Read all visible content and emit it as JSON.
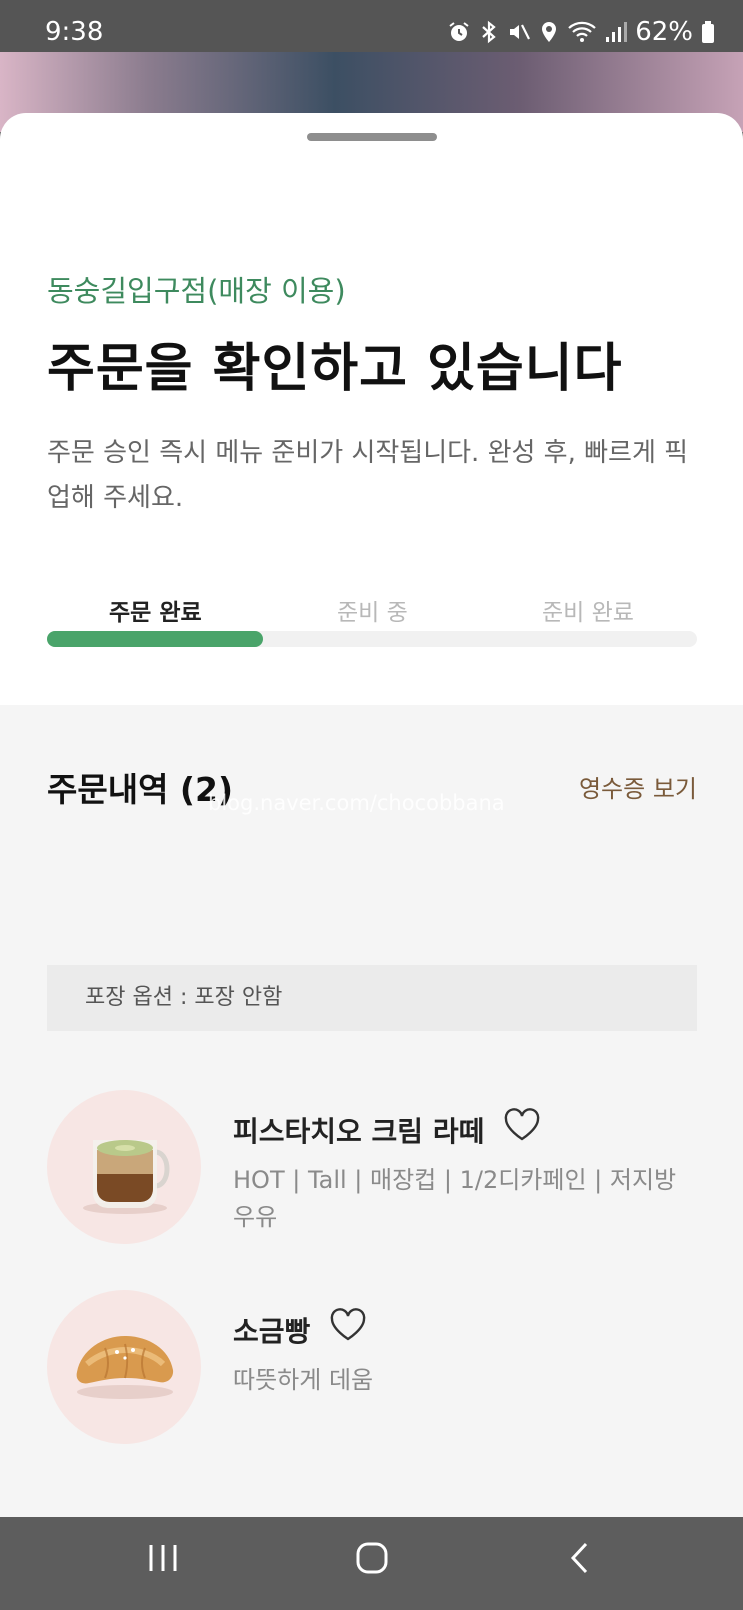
{
  "status_bar": {
    "time": "9:38",
    "battery": "62%",
    "icons": [
      "alarm-icon",
      "bluetooth-icon",
      "mute-icon",
      "location-icon",
      "wifi-icon",
      "signal-icon",
      "battery-icon"
    ]
  },
  "order": {
    "store": "동숭길입구점(매장 이용)",
    "title": "주문을 확인하고 있습니다",
    "description": "주문 승인 즉시 메뉴 준비가 시작됩니다. 완성 후, 빠르게 픽업해 주세요.",
    "steps": [
      "주문 완료",
      "준비 중",
      "준비 완료"
    ],
    "current_step": 1,
    "progress_fraction": 0.333
  },
  "history": {
    "title": "주문내역 (2)",
    "receipt_label": "영수증 보기",
    "watermark": "blog.naver.com/chocobbana",
    "packaging_option": "포장 옵션 : 포장 안함",
    "items": [
      {
        "name": "피스타치오 크림 라떼",
        "options": "HOT | Tall | 매장컵 | 1/2디카페인 | 저지방 우유",
        "icon": "latte-image"
      },
      {
        "name": "소금빵",
        "options": "따뜻하게 데움",
        "icon": "salt-bread-image"
      }
    ]
  },
  "colors": {
    "accent_green": "#4aa46a",
    "store_green": "#3e8a5e",
    "receipt_brown": "#7a5a3a"
  },
  "nav": [
    "recent-apps-icon",
    "home-icon",
    "back-icon"
  ]
}
